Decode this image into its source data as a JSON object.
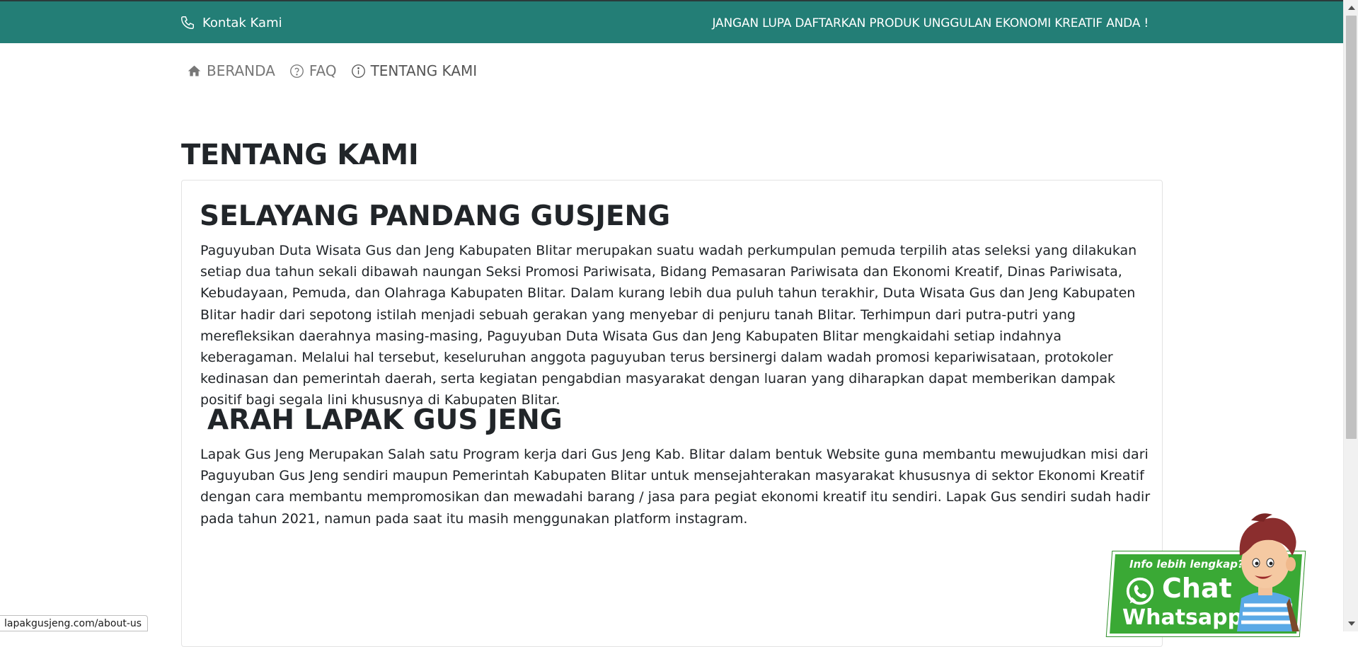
{
  "topbar": {
    "contact_label": "Kontak Kami",
    "promo_text": "JANGAN LUPA DAFTARKAN PRODUK UNGGULAN EKONOMI KREATIF ANDA !",
    "bg_color": "#237e76"
  },
  "nav": {
    "items": [
      {
        "label": "BERANDA",
        "icon": "home-icon"
      },
      {
        "label": "FAQ",
        "icon": "question-circle-icon"
      },
      {
        "label": "TENTANG KAMI",
        "icon": "info-circle-icon"
      }
    ]
  },
  "main": {
    "page_title": "TENTANG KAMI",
    "sections": [
      {
        "heading": "SELAYANG PANDANG GUSJENG",
        "body": "Paguyuban Duta Wisata Gus dan Jeng Kabupaten Blitar merupakan suatu wadah perkumpulan pemuda terpilih atas seleksi yang dilakukan setiap dua tahun sekali dibawah naungan Seksi Promosi Pariwisata, Bidang Pemasaran Pariwisata dan Ekonomi Kreatif, Dinas Pariwisata, Kebudayaan, Pemuda, dan Olahraga Kabupaten Blitar. Dalam kurang lebih dua puluh tahun terakhir, Duta Wisata Gus dan Jeng Kabupaten Blitar hadir dari sepotong istilah menjadi sebuah gerakan yang menyebar di penjuru tanah Blitar. Terhimpun dari putra-putri yang merefleksikan daerahnya masing-masing, Paguyuban Duta Wisata Gus dan Jeng Kabupaten Blitar mengkaidahi setiap indahnya keberagaman. Melalui hal tersebut, keseluruhan anggota paguyuban terus bersinergi dalam wadah promosi kepariwisataan, protokoler kedinasan dan pemerintah daerah, serta kegiatan pengabdian masyarakat dengan luaran yang diharapkan dapat memberikan dampak positif bagi segala lini khususnya di Kabupaten Blitar."
      },
      {
        "heading": "ARAH LAPAK GUS JENG",
        "body": "Lapak Gus Jeng Merupakan Salah satu Program kerja dari Gus Jeng Kab. Blitar dalam bentuk Website guna membantu mewujudkan misi dari Paguyuban Gus Jeng sendiri maupun Pemerintah Kabupaten Blitar untuk mensejahterakan masyarakat khususnya di sektor Ekonomi Kreatif dengan cara membantu mempromosikan dan mewadahi barang / jasa para pegiat ekonomi kreatif itu sendiri. Lapak Gus sendiri sudah hadir pada tahun 2021, namun pada saat itu masih menggunakan platform instagram."
      }
    ]
  },
  "whatsapp_widget": {
    "info_text": "Info lebih lengkap?",
    "chat_text": "Chat",
    "whatsapp_text": "Whatsapp",
    "color": "#3aa935"
  },
  "status_bar": {
    "url": "lapakgusjeng.com/about-us"
  }
}
